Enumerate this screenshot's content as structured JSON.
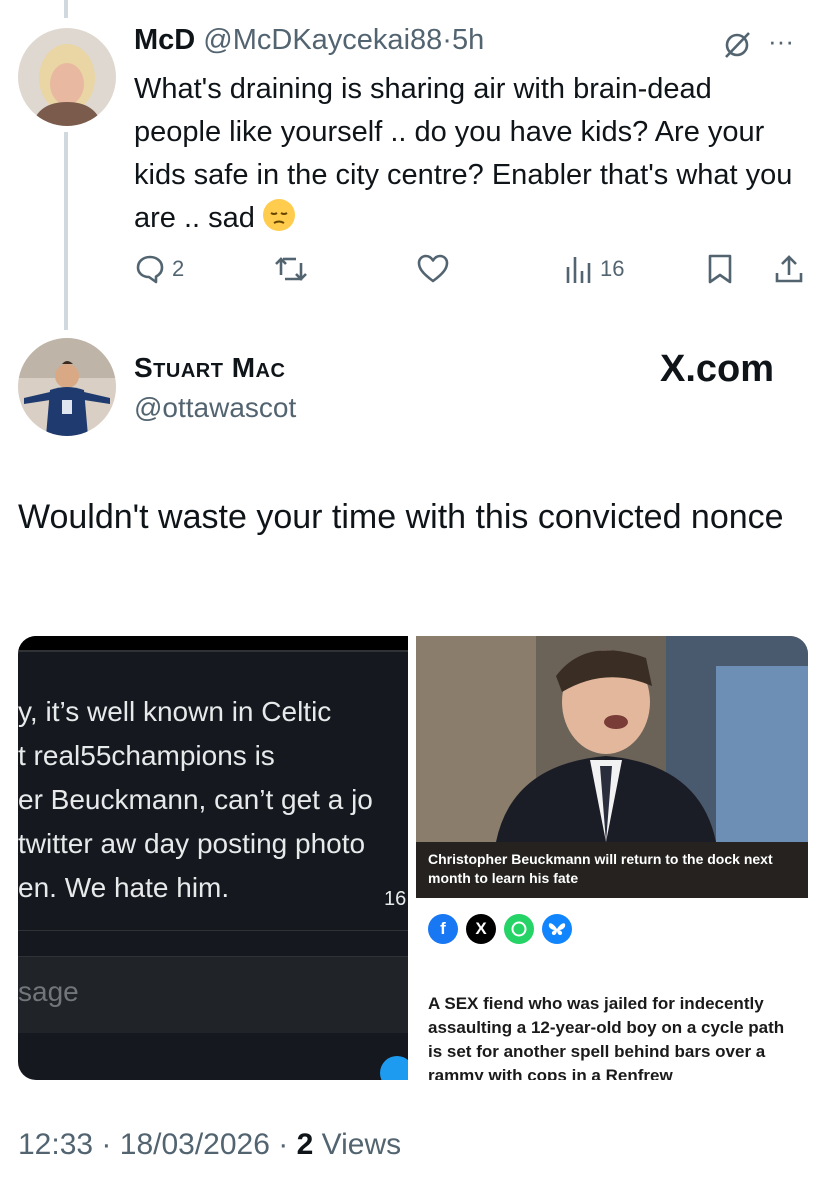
{
  "reply": {
    "display_name": "McD",
    "handle": "@McDKaycekai88",
    "separator": "·",
    "age": "5h",
    "text": "What's draining is sharing air with brain-dead people like yourself .. do you have kids? Are your kids safe in the city centre? Enabler that's what you are .. sad",
    "emoji": "😔",
    "reply_count": "2",
    "view_count": "16",
    "more_label": "···"
  },
  "quoted": {
    "display_name": "Stuart Mac",
    "handle": "@ottawascot",
    "watermark": "X.com",
    "text": "Wouldn't waste your time with this convicted nonce"
  },
  "dark_screenshot": {
    "lines": [
      "y, it’s well known in Celtic",
      "t real55champions is",
      "er Beuckmann, can’t get a jo",
      "twitter aw day posting photo",
      "en. We hate him."
    ],
    "small_number": "16",
    "message_placeholder": "sage"
  },
  "news_card": {
    "caption": "Christopher Beuckmann will return to the dock next month to learn his fate",
    "article_text": "A SEX fiend who was jailed for indecently assaulting a 12-year-old boy on a cycle path is set for another spell behind bars over a rammy with cops in a Renfrew",
    "share_icons": [
      "facebook-icon",
      "x-icon",
      "whatsapp-icon",
      "bluesky-icon"
    ],
    "colors": {
      "facebook": "#1877f2",
      "x": "#000000",
      "whatsapp": "#25d366",
      "bluesky": "#1185fe",
      "caption_bg": "#25221f"
    }
  },
  "footer": {
    "time": "12:33",
    "date": "18/03/2026",
    "separator": "·",
    "views_count": "2",
    "views_label": "Views"
  },
  "colors": {
    "text": "#0f1419",
    "muted": "#536471",
    "thread_line": "#cfd9de"
  }
}
